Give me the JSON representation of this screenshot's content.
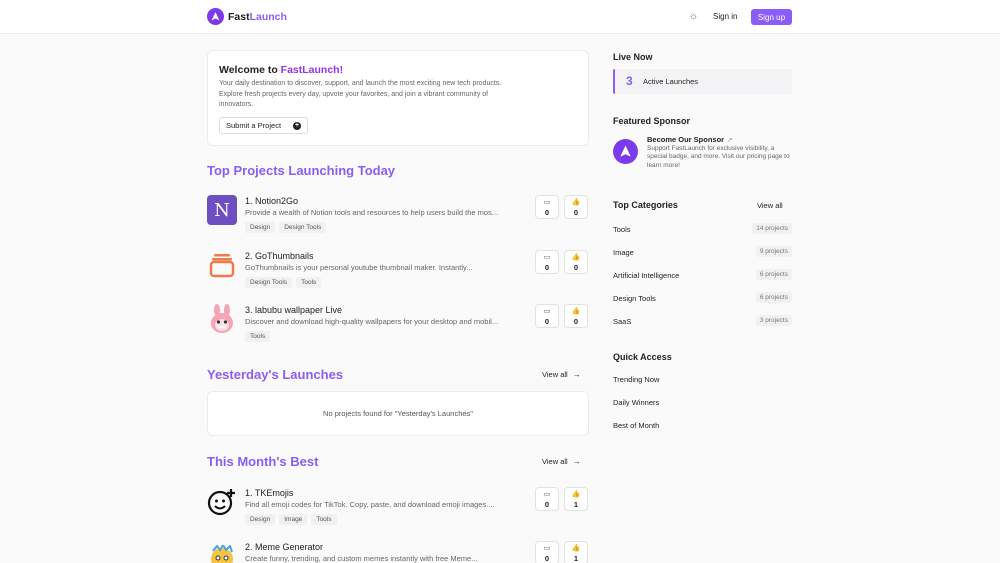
{
  "header": {
    "brand_part1": "Fast",
    "brand_part2": "Launch",
    "signin": "Sign in",
    "signup": "Sign up"
  },
  "welcome": {
    "title_prefix": "Welcome to ",
    "title_brand": "FastLaunch!",
    "body": "Your daily destination to discover, support, and launch the most exciting new tech products. Explore fresh projects every day, upvote your favorites, and join a vibrant community of innovators.",
    "submit": "Submit a Project"
  },
  "today": {
    "title": "Top Projects Launching Today",
    "projects": [
      {
        "name": "1. Notion2Go",
        "desc": "Provide a wealth of Notion tools and resources to help users build the mos...",
        "tags": [
          "Design",
          "Design Tools"
        ],
        "comments": "0",
        "upvotes": "0",
        "thumb_letter": "N"
      },
      {
        "name": "2. GoThumbnails",
        "desc": "GoThumbnails is your personal youtube thumbnail maker. Instantly...",
        "tags": [
          "Design Tools",
          "Tools"
        ],
        "comments": "0",
        "upvotes": "0"
      },
      {
        "name": "3. labubu wallpaper Live",
        "desc": "Discover and download high-quality wallpapers for your desktop and mobil...",
        "tags": [
          "Tools"
        ],
        "comments": "0",
        "upvotes": "0"
      }
    ]
  },
  "yesterday": {
    "title": "Yesterday's Launches",
    "view_all": "View all",
    "empty": "No projects found for \"Yesterday's Launches\""
  },
  "month": {
    "title": "This Month's Best",
    "view_all": "View all",
    "projects": [
      {
        "name": "1. TKEmojis",
        "desc": "Find all emoji codes for TikTok. Copy, paste, and download emoji images....",
        "tags": [
          "Design",
          "Image",
          "Tools"
        ],
        "comments": "0",
        "upvotes": "1"
      },
      {
        "name": "2. Meme Generator",
        "desc": "Create funny, trending, and custom memes instantly with free Meme...",
        "tags": [],
        "comments": "0",
        "upvotes": "1"
      }
    ]
  },
  "sidebar": {
    "live_title": "Live Now",
    "live_count": "3",
    "live_label": "Active Launches",
    "sponsor_title": "Featured Sponsor",
    "sponsor_name": "Become Our Sponsor",
    "sponsor_desc": "Support FastLaunch for exclusive visibility, a special badge, and more. Visit our pricing page to learn more!",
    "categories_title": "Top Categories",
    "categories_view_all": "View all",
    "categories": [
      {
        "name": "Tools",
        "count": "14 projects"
      },
      {
        "name": "Image",
        "count": "9 projects"
      },
      {
        "name": "Artificial Intelligence",
        "count": "6 projects"
      },
      {
        "name": "Design Tools",
        "count": "6 projects"
      },
      {
        "name": "SaaS",
        "count": "3 projects"
      }
    ],
    "quick_title": "Quick Access",
    "quick": [
      "Trending Now",
      "Daily Winners",
      "Best of Month"
    ]
  },
  "colors": {
    "accent": "#8b5cf6",
    "brand": "#7c3aed"
  }
}
